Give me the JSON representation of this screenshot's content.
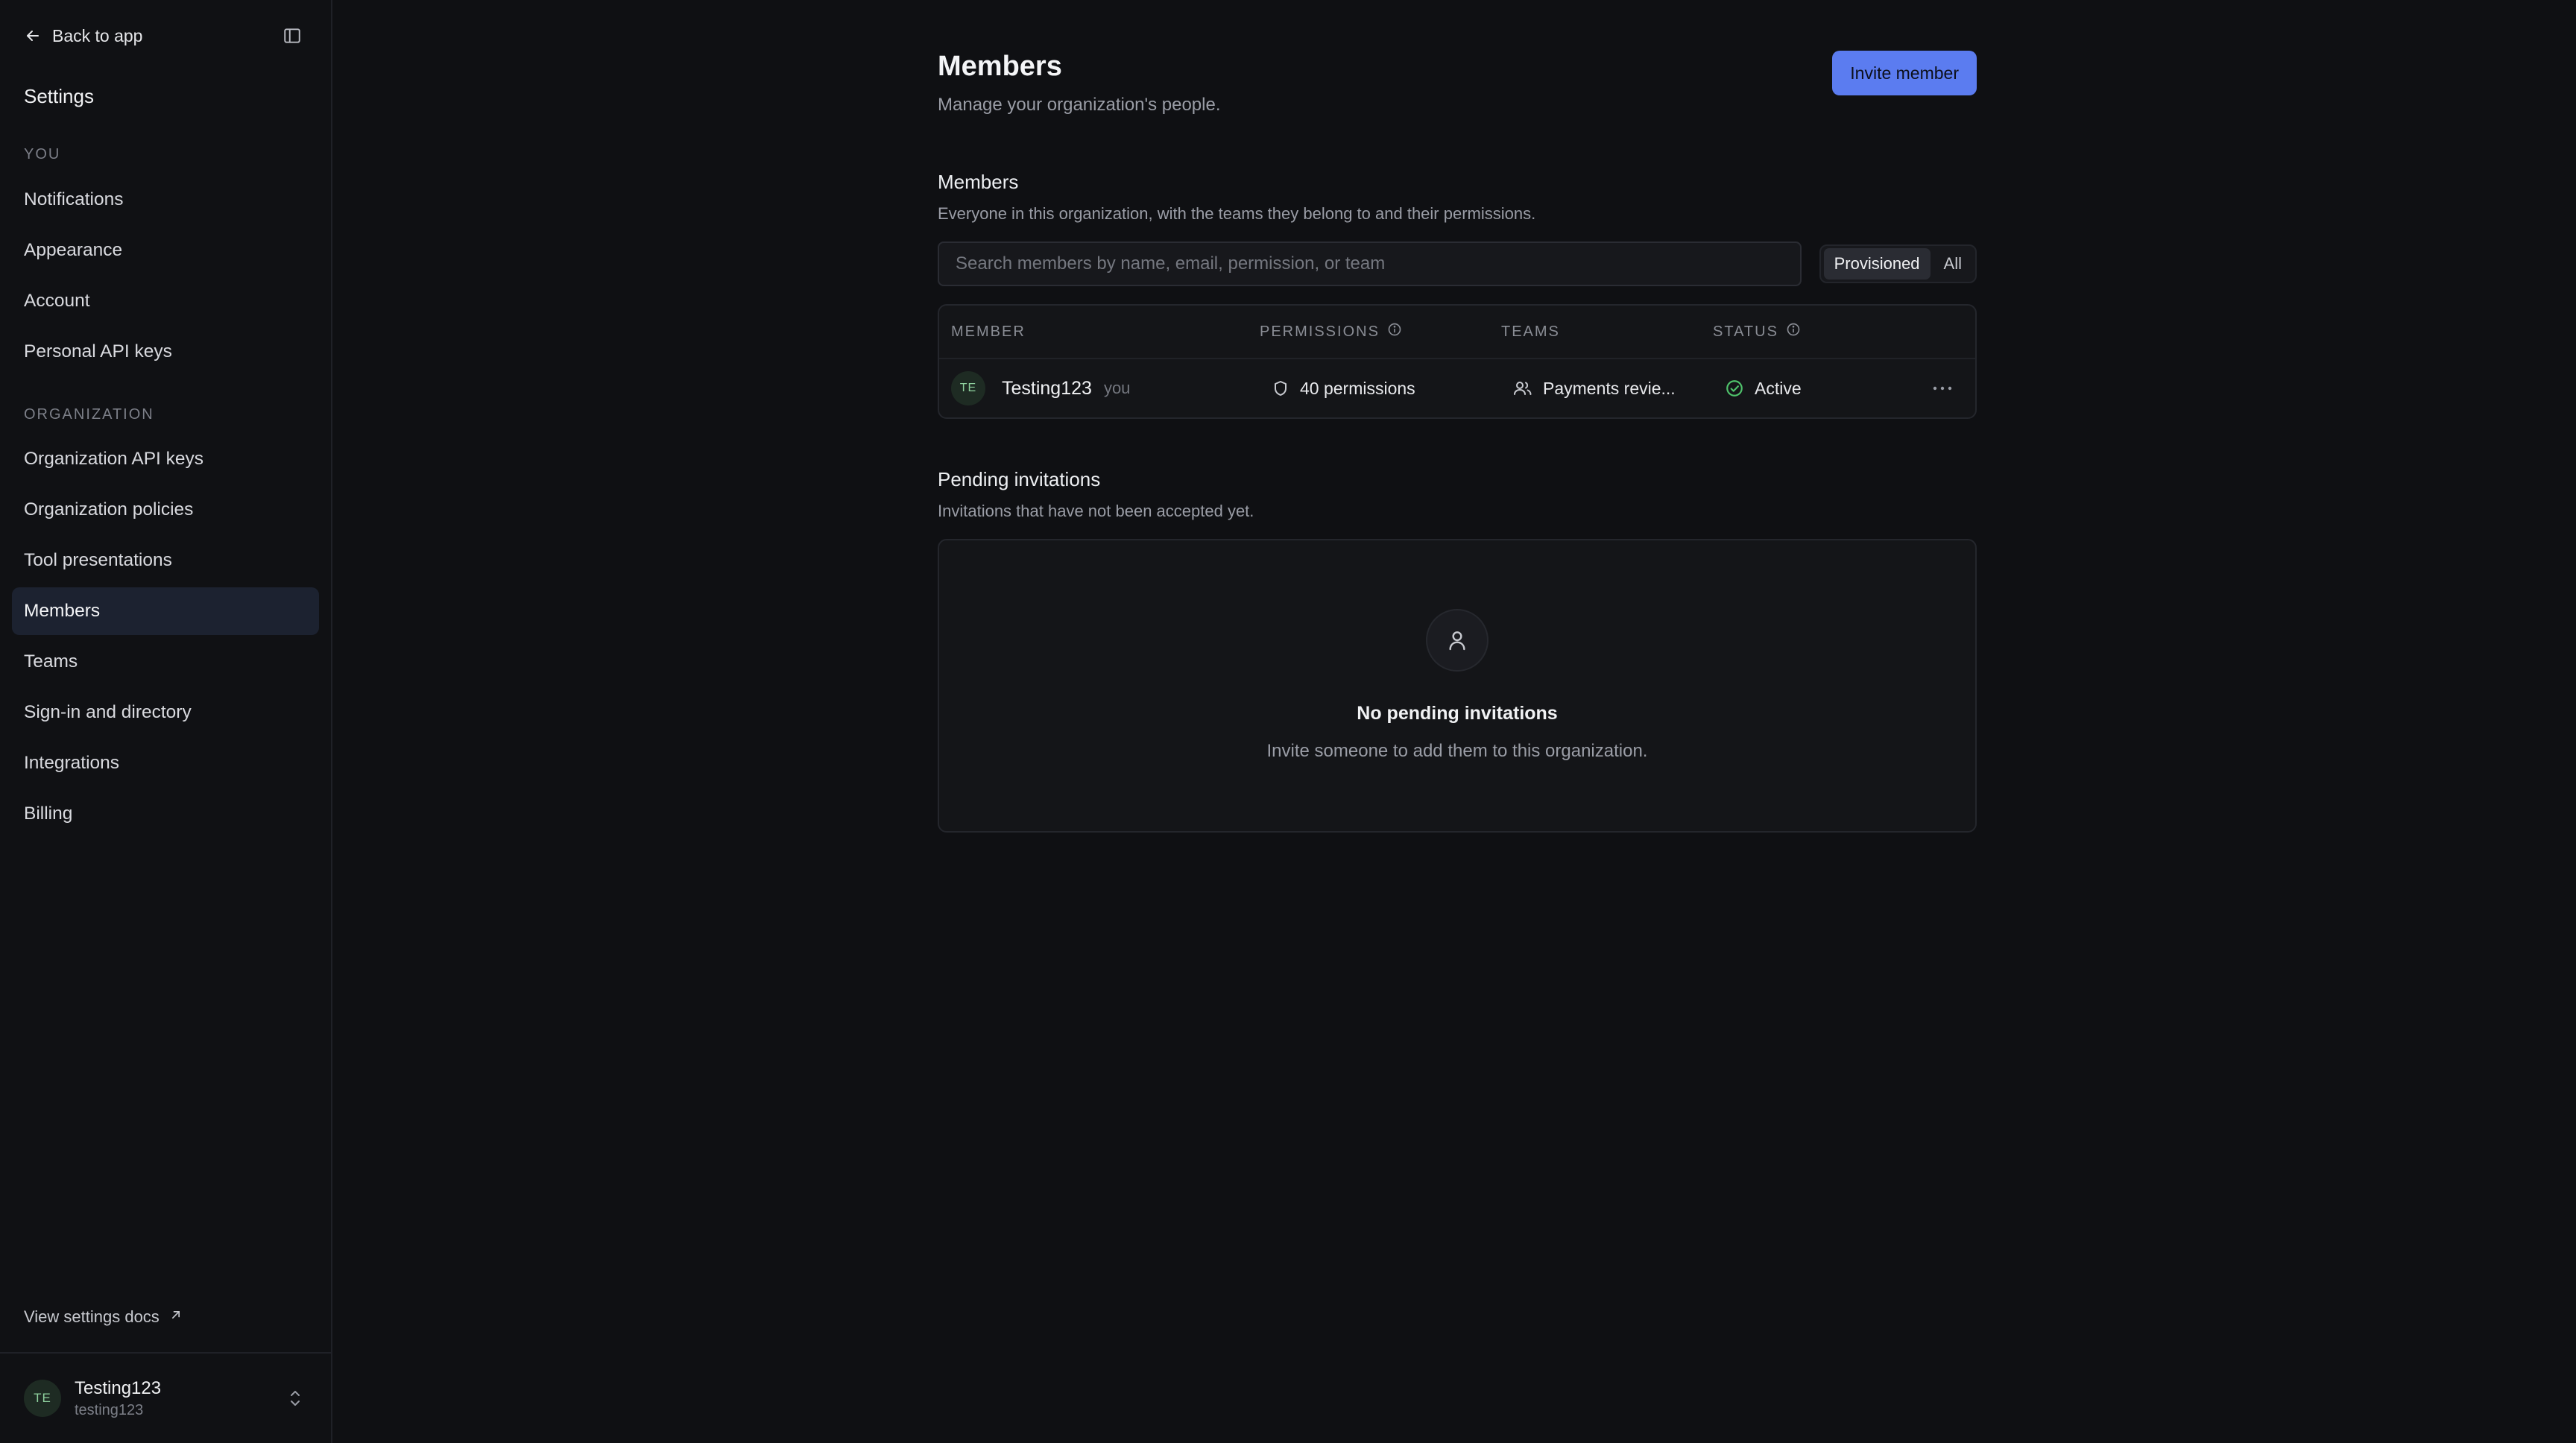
{
  "sidebar": {
    "back_label": "Back to app",
    "settings_title": "Settings",
    "section_you": "YOU",
    "you_items": [
      {
        "label": "Notifications"
      },
      {
        "label": "Appearance"
      },
      {
        "label": "Account"
      },
      {
        "label": "Personal API keys"
      }
    ],
    "section_org": "ORGANIZATION",
    "org_items": [
      {
        "label": "Organization API keys"
      },
      {
        "label": "Organization policies"
      },
      {
        "label": "Tool presentations"
      },
      {
        "label": "Members",
        "active": true
      },
      {
        "label": "Teams"
      },
      {
        "label": "Sign-in and directory"
      },
      {
        "label": "Integrations"
      },
      {
        "label": "Billing"
      }
    ],
    "docs_link": "View settings docs",
    "user": {
      "initials": "TE",
      "name": "Testing123",
      "handle": "testing123"
    }
  },
  "page": {
    "title": "Members",
    "subtitle": "Manage your organization's people.",
    "invite_label": "Invite member"
  },
  "members": {
    "title": "Members",
    "description": "Everyone in this organization, with the teams they belong to and their permissions.",
    "search_placeholder": "Search members by name, email, permission, or team",
    "filters": {
      "provisioned": "Provisioned",
      "all": "All",
      "selected": "Provisioned"
    },
    "columns": {
      "member": "MEMBER",
      "permissions": "PERMISSIONS",
      "teams": "TEAMS",
      "status": "STATUS"
    },
    "rows": [
      {
        "initials": "TE",
        "name": "Testing123",
        "tag": "you",
        "permissions": "40 permissions",
        "teams": "Payments revie...",
        "status": "Active"
      }
    ]
  },
  "pending": {
    "title": "Pending invitations",
    "description": "Invitations that have not been accepted yet.",
    "empty_title": "No pending invitations",
    "empty_desc": "Invite someone to add them to this organization."
  },
  "colors": {
    "accent": "#5b7cf0",
    "active_status": "#4fc26b",
    "background": "#0f1013"
  },
  "icons": [
    "arrow-left-icon",
    "sidebar-toggle-icon",
    "external-link-icon",
    "chevron-updown-icon",
    "info-icon",
    "shield-icon",
    "users-icon",
    "check-circle-icon",
    "more-horizontal-icon",
    "user-icon"
  ]
}
